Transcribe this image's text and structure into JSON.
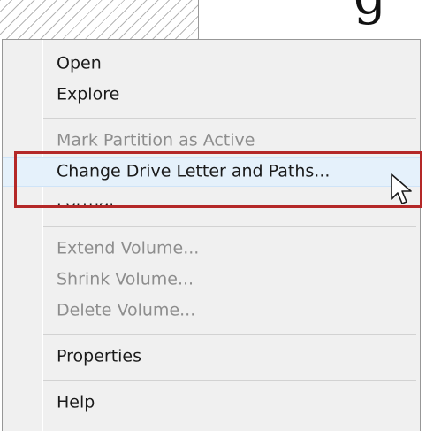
{
  "context_menu": {
    "items": [
      {
        "label": "Open",
        "enabled": true
      },
      {
        "label": "Explore",
        "enabled": true
      },
      {
        "label": "Mark Partition as Active",
        "enabled": false
      },
      {
        "label": "Change Drive Letter and Paths...",
        "enabled": true,
        "hovered": true
      },
      {
        "label": "Format...",
        "enabled": true
      },
      {
        "label": "Extend Volume...",
        "enabled": false
      },
      {
        "label": "Shrink Volume...",
        "enabled": false
      },
      {
        "label": "Delete Volume...",
        "enabled": false
      },
      {
        "label": "Properties",
        "enabled": true
      },
      {
        "label": "Help",
        "enabled": true
      }
    ]
  },
  "background": {
    "glyph": "g"
  },
  "colors": {
    "menu_background": "#f0f0f0",
    "hover_background": "#e5f1fb",
    "highlight_box": "#b42828",
    "disabled_text": "#8d8d8d",
    "text": "#1a1a1a"
  },
  "icons": {
    "cursor": "arrow-cursor-icon"
  }
}
